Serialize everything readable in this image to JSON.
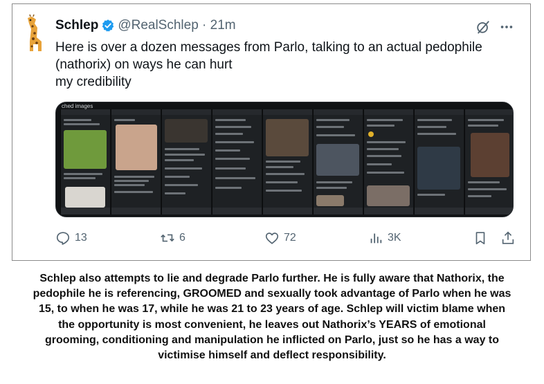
{
  "tweet": {
    "author_name": "Schlep",
    "handle_time": "@RealSchlep · 21m",
    "text_lines": [
      "Here is over a dozen messages from Parlo, talking to an actual pedophile",
      "(nathorix) on ways he can hurt",
      "my credibility"
    ],
    "media_label": "ched images",
    "icons": [
      "giraffe-avatar",
      "verified-badge-icon",
      "grok-icon",
      "more-icon",
      "reply-icon",
      "repost-icon",
      "like-icon",
      "views-icon",
      "bookmark-icon",
      "share-icon"
    ],
    "actions": {
      "replies": "13",
      "reposts": "6",
      "likes": "72",
      "views": "3K"
    },
    "colors": {
      "verified": "#1d9bf0",
      "secondary_text": "#536471",
      "primary_text": "#0f1419"
    }
  },
  "caption_lines": [
    "Schlep also attempts to lie and degrade Parlo further. He is fully aware that Nathorix, the",
    "pedophile he is referencing, GROOMED and sexually took advantage of Parlo when he was",
    "15, to when he was 17, while he was 21 to 23 years of age. Schlep will victim blame when",
    "the opportunity is most convenient, he leaves out Nathorix’s YEARS of emotional",
    "grooming, conditioning and manipulation he inflicted on Parlo, just so he has a way to",
    "victimise himself and deflect responsibility."
  ]
}
